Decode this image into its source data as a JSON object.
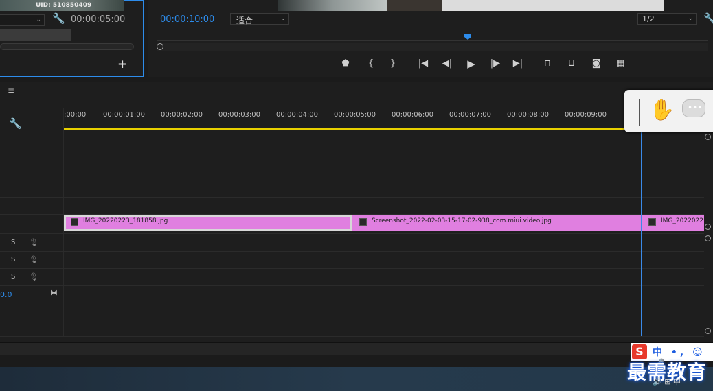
{
  "source_monitor": {
    "uid_text": "UID: 510850409",
    "timecode": "00:00:05:00",
    "add_button": "+"
  },
  "program_monitor": {
    "timecode": "00:00:10:00",
    "fit_label": "适合",
    "resolution_label": "1/2",
    "transport": {
      "marker": "marker-icon",
      "mark_in": "{",
      "mark_out": "}",
      "go_to_in": "go-to-in-icon",
      "step_back": "step-back-icon",
      "play": "play-icon",
      "step_forward": "step-forward-icon",
      "go_to_out": "go-to-out-icon",
      "lift": "lift-icon",
      "extract": "extract-icon",
      "export_frame": "camera-icon",
      "compare": "compare-icon"
    }
  },
  "timeline": {
    "menu_icon": "≡",
    "ruler_labels": [
      ":00:00",
      "00:00:01:00",
      "00:00:02:00",
      "00:00:03:00",
      "00:00:04:00",
      "00:00:05:00",
      "00:00:06:00",
      "00:00:07:00",
      "00:00:08:00",
      "00:00:09:00"
    ],
    "clips": [
      {
        "name": "IMG_20220223_181858.jpg"
      },
      {
        "name": "Screenshot_2022-02-03-15-17-02-938_com.miui.video.jpg"
      },
      {
        "name": "IMG_2022022"
      }
    ],
    "audio_tracks": [
      {
        "solo": "S"
      },
      {
        "solo": "S"
      },
      {
        "solo": "S"
      }
    ],
    "master_value": "0.0",
    "colors": {
      "clip": "#e07fe0",
      "work_area": "#e8d000",
      "accent": "#2d8ceb"
    }
  },
  "ime": {
    "logo": "S",
    "status": "中 •, ☺ 🎤"
  },
  "watermark_text": "最需教育",
  "tray_text": "🔊 ⊞ 中"
}
